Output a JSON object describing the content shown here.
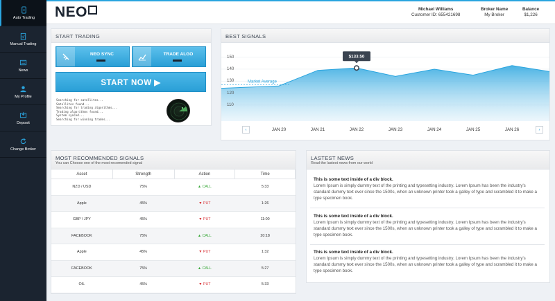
{
  "sidebar": {
    "items": [
      {
        "label": "Auto Trading",
        "icon": "tablet-icon"
      },
      {
        "label": "Manual Trading",
        "icon": "clipboard-icon"
      },
      {
        "label": "News",
        "icon": "newspaper-icon"
      },
      {
        "label": "My Profile",
        "icon": "user-icon"
      },
      {
        "label": "Deposit",
        "icon": "deposit-icon"
      },
      {
        "label": "Change Broker",
        "icon": "refresh-icon"
      }
    ]
  },
  "header": {
    "logo": "NEO",
    "user_name": "Michael Williams",
    "customer_id": "Customer ID: 655421698",
    "broker_label": "Broker Name",
    "broker_value": "My Broker",
    "balance_label": "Balance",
    "balance_value": "$1,226"
  },
  "start_trading": {
    "title": "START TRADING",
    "neo_sync": "NEO SYNC",
    "trade_algo": "TRADE ALGO",
    "start_now": "START NOW ▶",
    "log": [
      "Searching for satellites...",
      "Satellites found...",
      "Searching for trading algorithms...",
      "Trading algorithms found...",
      "System synced...",
      "Searching for winning trades..."
    ]
  },
  "best_signals": {
    "title": "BEST SIGNALS",
    "tooltip": "$133.50",
    "market_average_label": "Market Average",
    "prev_icon": "chevron-left-icon",
    "next_icon": "chevron-right-icon"
  },
  "chart_data": {
    "type": "area",
    "x": [
      "",
      "JAN 20",
      "JAN 21",
      "JAN 22",
      "JAN 23",
      "JAN 24",
      "JAN 25",
      "JAN 26",
      ""
    ],
    "values": [
      124,
      126,
      139,
      141,
      134,
      140,
      135,
      143,
      138
    ],
    "market_average": 127,
    "yticks": [
      150,
      140,
      130,
      120,
      110
    ],
    "ylim": [
      103,
      155
    ],
    "highlight": {
      "x": "JAN 22",
      "label": "$133.50"
    }
  },
  "recommended": {
    "title": "MOST RECOMMENDED SIGNALS",
    "subtitle": "You can Choose one of the most recomended signal",
    "columns": [
      "Asset",
      "Strength",
      "Action",
      "Time"
    ],
    "rows": [
      [
        "NZD / USD",
        "75%",
        "▲ CALL",
        "5:33"
      ],
      [
        "Apple",
        "45%",
        "▼ PUT",
        "1:26"
      ],
      [
        "GBP \\ JPY",
        "45%",
        "▼ PUT",
        "11:00"
      ],
      [
        "FACEBOOK",
        "75%",
        "▲ CALL",
        "20:18"
      ],
      [
        "Apple",
        "45%",
        "▼ PUT",
        "1:32"
      ],
      [
        "FACEBOOK",
        "75%",
        "▲ CALL",
        "5:27"
      ],
      [
        "OIL",
        "45%",
        "▼ PUT",
        "5:33"
      ]
    ]
  },
  "news": {
    "title": "LASTEST NEWS",
    "subtitle": "Read the lastest news from our world",
    "items": [
      {
        "title": "This is some text inside of a div block.",
        "body": "Lorem Ipsum is simply dummy text of the printing and typesetting industry. Lorem Ipsum has been the industry's standard dummy text ever since the 1500s, when an unknown printer took a galley of type and scrambled it to make a type specimen book."
      },
      {
        "title": "This is some text inside of a div block.",
        "body": "Lorem Ipsum is simply dummy text of the printing and typesetting industry. Lorem Ipsum has been the industry's standard dummy text ever since the 1500s, when an unknown printer took a galley of type and scrambled it to make a type specimen book."
      },
      {
        "title": "This is some text inside of a div block.",
        "body": "Lorem Ipsum is simply dummy text of the printing and typesetting industry. Lorem Ipsum has been the industry's standard dummy text ever since the 1500s, when an unknown printer took a galley of type and scrambled it to make a type specimen book."
      }
    ]
  },
  "colors": {
    "accent": "#2aa5df",
    "sidebar": "#1b2430",
    "call": "#3aa93a",
    "put": "#d9373b"
  }
}
